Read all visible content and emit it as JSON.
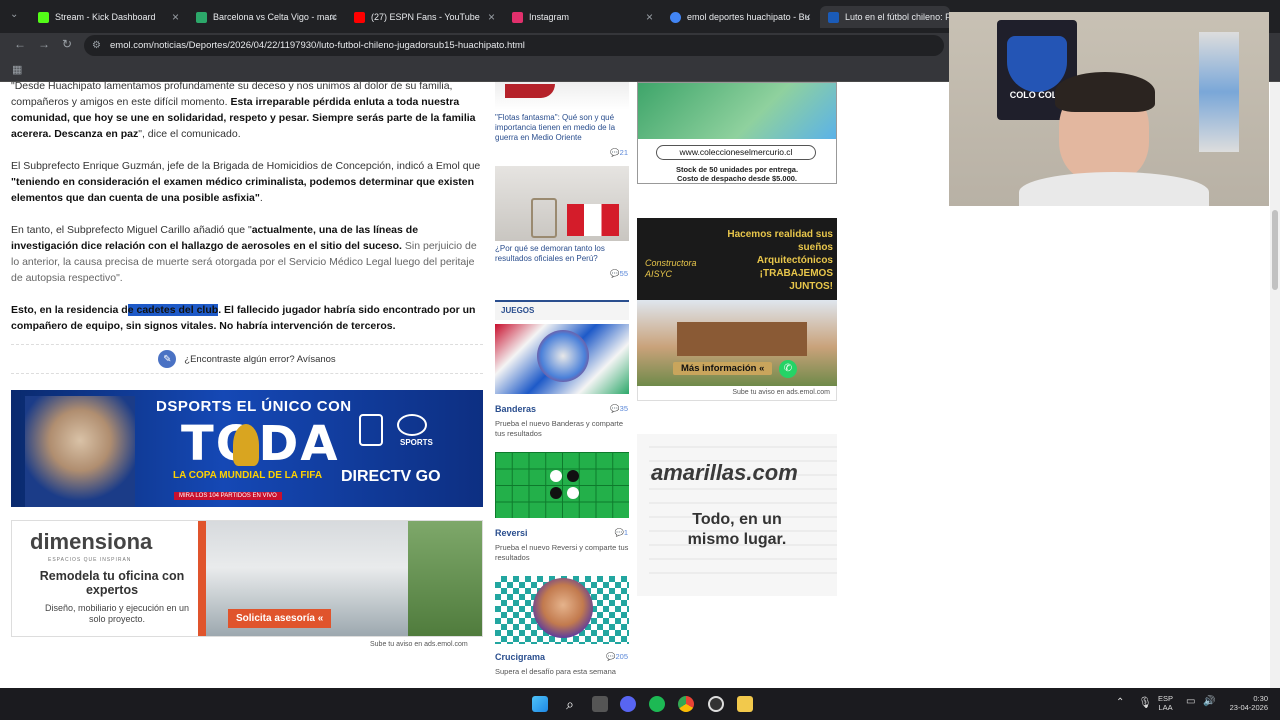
{
  "browser": {
    "tabs": [
      {
        "title": "Stream - Kick Dashboard",
        "fav_color": "#53fc18"
      },
      {
        "title": "Barcelona vs Celta Vigo - marc",
        "fav_color": "#2ca86a"
      },
      {
        "title": "(27) ESPN Fans - YouTube",
        "fav_color": "#ff0000"
      },
      {
        "title": "Instagram",
        "fav_color": "#e1306c"
      },
      {
        "title": "emol deportes huachipato - Bu",
        "fav_color": "#4285f4"
      },
      {
        "title": "Luto en el fútbol chileno: Falle",
        "fav_color": "#1a5bb8"
      }
    ],
    "url": "emol.com/noticias/Deportes/2026/04/22/1197930/luto-futbol-chileno-jugadorsub15-huachipato.html"
  },
  "article": {
    "p1": {
      "a": "\"Desde Huachipato lamentamos profundamente su deceso y nos unimos al dolor de su familia, compañeros y amigos en este difícil momento. ",
      "b": "Esta irreparable pérdida enluta a toda nuestra comunidad, que hoy se une en solidaridad, respeto y pesar. Siempre serás parte de la familia acerera. Descanza en paz",
      "c": "\", dice el comunicado."
    },
    "p2": {
      "a": "El Subprefecto Enrique Guzmán, jefe de la Brigada de Homicidios de Concepción, indicó a Emol que ",
      "b": "\"teniendo en consideración el examen médico criminalista, podemos determinar que existen elementos que dan cuenta de una posible asfixia\"",
      "c": "."
    },
    "p3": {
      "a": "En tanto, el Subprefecto Miguel Carillo añadió que \"",
      "b": "actualmente, una de las líneas de investigación dice relación con el hallazgo de aerosoles en el sitio del suceso.",
      "c": " Sin perjuicio de lo anterior, la causa precisa de muerte será otorgada por el Servicio Médico Legal luego del peritaje de autopsia respectivo\"."
    },
    "p4": {
      "a": "Esto, en la residencia d",
      "hl": "e cadetes del club",
      "b": ". El fallecido jugador habría sido encontrado por un compañero de equipo, sin signos vitales. No habría intervención de terceros."
    },
    "error_link": "¿Encontraste algún error? Avísanos"
  },
  "ads": {
    "directv": {
      "line1": "DSPORTS EL ÚNICO CON",
      "big": "TODA",
      "line2": "LA COPA MUNDIAL DE LA FIFA",
      "line3": "MIRA LOS 104 PARTIDOS EN VIVO",
      "brand": "DIRECTV GO",
      "sports": "SPORTS"
    },
    "dimensiona": {
      "brand": "dimensiona",
      "tagline": "ESPACIOS QUE INSPIRAN",
      "headline": "Remodela tu oficina con expertos",
      "sub": "Diseño, mobiliario y ejecución en un solo proyecto.",
      "cta": "Solicita asesoría «"
    },
    "sube_aviso_1": "Sube tu aviso en ads.emol.com",
    "colecciones": {
      "url": "www.coleccioneselmercurio.cl",
      "line1": "Stock de 50 unidades por entrega.",
      "line2": "Costo de despacho desde $5.000."
    },
    "aisyc": {
      "headline": "Hacemos realidad sus sueños Arquitectónicos ¡TRABAJEMOS JUNTOS!",
      "brand": "Constructora AISYC",
      "cta": "Más información «"
    },
    "sube_aviso_2": "Sube tu aviso en ads.emol.com",
    "amarillas": {
      "brand": "amarillas.com",
      "slogan": "Todo, en un mismo lugar."
    }
  },
  "sidebar": {
    "news1": {
      "caption": "\"Flotas fantasma\": Qué son y qué importancia tienen en medio de la guerra en Medio Oriente",
      "count": "21"
    },
    "news2": {
      "caption": "¿Por qué se demoran tanto los resultados oficiales en Perú?",
      "count": "55"
    },
    "games_header": "JUEGOS",
    "games": [
      {
        "title": "Banderas",
        "sub": "Prueba el nuevo Banderas y comparte tus resultados",
        "count": "35"
      },
      {
        "title": "Reversi",
        "sub": "Prueba el nuevo Reversi y comparte tus resultados",
        "count": "1"
      },
      {
        "title": "Crucigrama",
        "sub": "Supera el desafío para esta semana",
        "count": "205"
      }
    ]
  },
  "camera": {
    "banner": "COLO COLO"
  },
  "taskbar": {
    "lang1": "ESP",
    "lang2": "LAA",
    "time": "0:30",
    "date": "23-04-2026"
  }
}
